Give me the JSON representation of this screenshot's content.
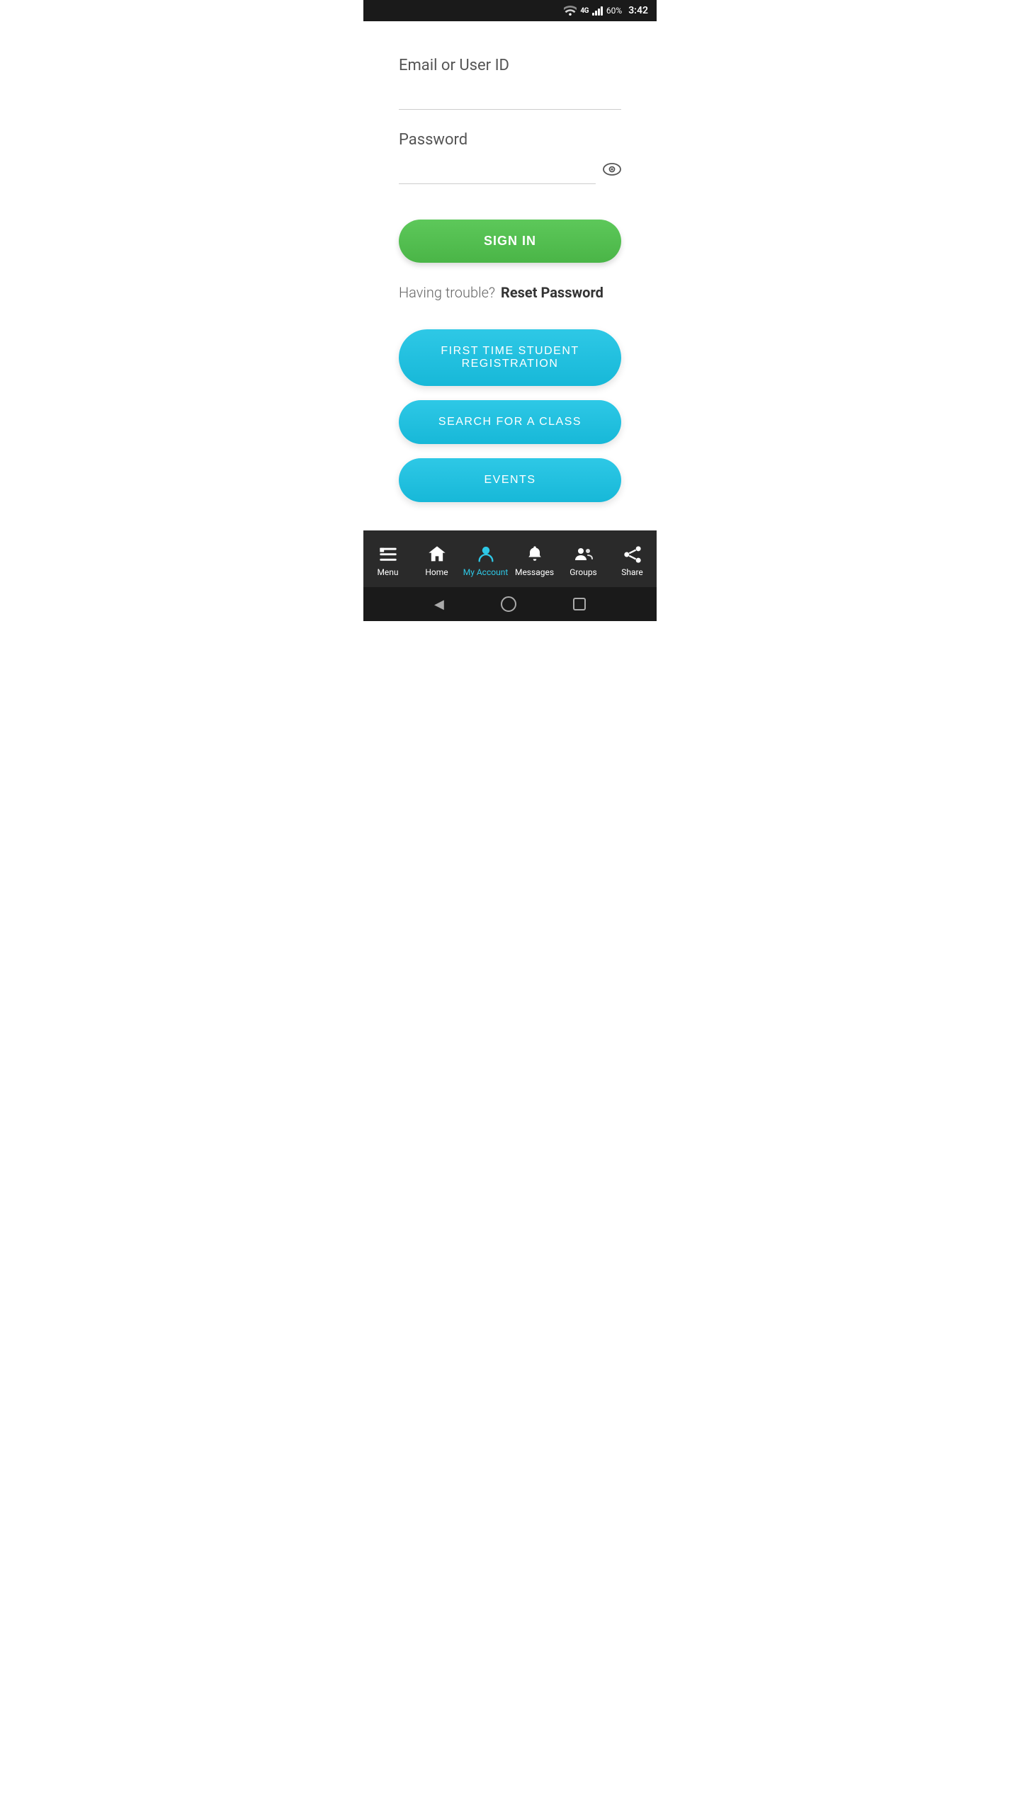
{
  "statusBar": {
    "battery": "60%",
    "time": "3:42",
    "network": "4G"
  },
  "form": {
    "emailLabel": "Email or User ID",
    "emailPlaceholder": "",
    "passwordLabel": "Password",
    "passwordPlaceholder": "",
    "signInButton": "SIGN IN",
    "troubleText": "Having trouble?",
    "resetLink": "Reset Password"
  },
  "buttons": {
    "registration": "FIRST TIME STUDENT REGISTRATION",
    "searchClass": "SEARCH FOR A CLASS",
    "events": "EVENTS"
  },
  "nav": {
    "items": [
      {
        "id": "menu",
        "label": "Menu",
        "active": false
      },
      {
        "id": "home",
        "label": "Home",
        "active": false
      },
      {
        "id": "myaccount",
        "label": "My Account",
        "active": true
      },
      {
        "id": "messages",
        "label": "Messages",
        "active": false
      },
      {
        "id": "groups",
        "label": "Groups",
        "active": false
      },
      {
        "id": "share",
        "label": "Share",
        "active": false
      }
    ]
  },
  "colors": {
    "green": "#4cb94a",
    "teal": "#1fc4df",
    "activeNav": "#2ec8e6",
    "navBg": "#2a2a2a"
  }
}
